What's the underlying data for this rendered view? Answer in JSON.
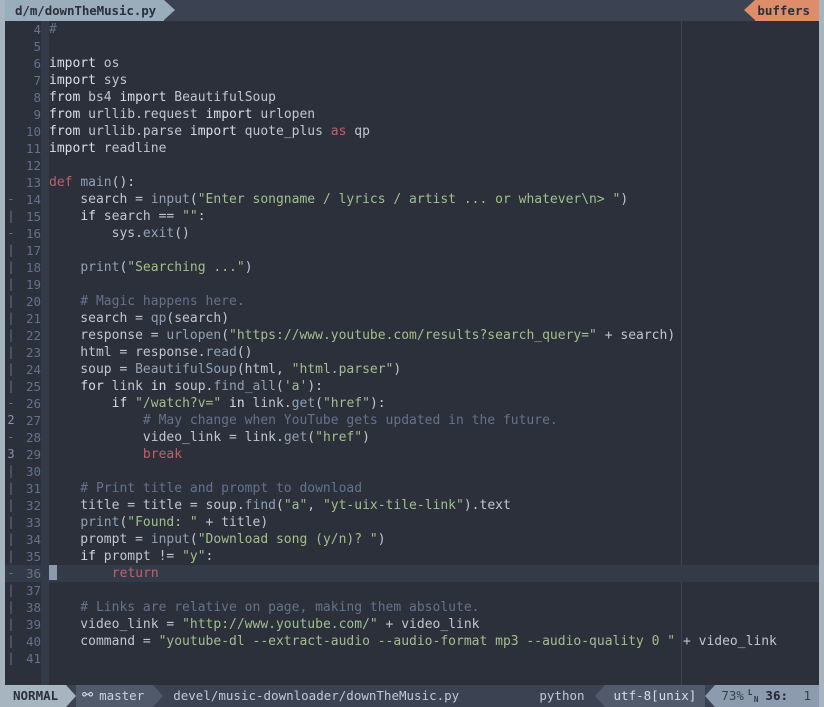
{
  "tabline": {
    "tab_label": "d/m/downTheMusic.py",
    "buffers_label": "buffers",
    "tab_bg": "#9aadbb",
    "buffers_bg": "#dd8d6a"
  },
  "editor": {
    "cursor_line": 36,
    "cursor_col": 1,
    "lines": [
      {
        "num": 4,
        "fold": "",
        "tokens": [
          {
            "t": "#",
            "c": "com"
          }
        ]
      },
      {
        "num": 5,
        "fold": "",
        "tokens": []
      },
      {
        "num": 6,
        "fold": "",
        "tokens": [
          {
            "t": "import",
            "c": "kw2"
          },
          {
            "t": " os",
            "c": "id"
          }
        ]
      },
      {
        "num": 7,
        "fold": "",
        "tokens": [
          {
            "t": "import",
            "c": "kw2"
          },
          {
            "t": " sys",
            "c": "id"
          }
        ]
      },
      {
        "num": 8,
        "fold": "",
        "tokens": [
          {
            "t": "from",
            "c": "kw2"
          },
          {
            "t": " bs4 ",
            "c": "id"
          },
          {
            "t": "import",
            "c": "kw2"
          },
          {
            "t": " BeautifulSoup",
            "c": "id"
          }
        ]
      },
      {
        "num": 9,
        "fold": "",
        "tokens": [
          {
            "t": "from",
            "c": "kw2"
          },
          {
            "t": " urllib.request ",
            "c": "id"
          },
          {
            "t": "import",
            "c": "kw2"
          },
          {
            "t": " urlopen",
            "c": "id"
          }
        ]
      },
      {
        "num": 10,
        "fold": "",
        "tokens": [
          {
            "t": "from",
            "c": "kw2"
          },
          {
            "t": " urllib.parse ",
            "c": "id"
          },
          {
            "t": "import",
            "c": "kw2"
          },
          {
            "t": " quote_plus ",
            "c": "id"
          },
          {
            "t": "as",
            "c": "kw"
          },
          {
            "t": " qp",
            "c": "id"
          }
        ]
      },
      {
        "num": 11,
        "fold": "",
        "tokens": [
          {
            "t": "import",
            "c": "kw2"
          },
          {
            "t": " readline",
            "c": "id"
          }
        ]
      },
      {
        "num": 12,
        "fold": "",
        "tokens": []
      },
      {
        "num": 13,
        "fold": "",
        "tokens": [
          {
            "t": "def",
            "c": "kw"
          },
          {
            "t": " ",
            "c": "id"
          },
          {
            "t": "main",
            "c": "fn"
          },
          {
            "t": "():",
            "c": "op"
          }
        ]
      },
      {
        "num": 14,
        "fold": "-",
        "tokens": [
          {
            "t": "    search = ",
            "c": "id"
          },
          {
            "t": "input",
            "c": "fn"
          },
          {
            "t": "(",
            "c": "op"
          },
          {
            "t": "\"Enter songname / lyrics / artist ... or whatever\\n> \"",
            "c": "str"
          },
          {
            "t": ")",
            "c": "op"
          }
        ]
      },
      {
        "num": 15,
        "fold": "|",
        "tokens": [
          {
            "t": "    ",
            "c": "id"
          },
          {
            "t": "if",
            "c": "kw2"
          },
          {
            "t": " search == ",
            "c": "id"
          },
          {
            "t": "\"\"",
            "c": "str"
          },
          {
            "t": ":",
            "c": "op"
          }
        ]
      },
      {
        "num": 16,
        "fold": "-",
        "tokens": [
          {
            "t": "        sys.",
            "c": "id"
          },
          {
            "t": "exit",
            "c": "fn"
          },
          {
            "t": "()",
            "c": "op"
          }
        ]
      },
      {
        "num": 17,
        "fold": "|",
        "tokens": []
      },
      {
        "num": 18,
        "fold": "|",
        "tokens": [
          {
            "t": "    ",
            "c": "id"
          },
          {
            "t": "print",
            "c": "fn"
          },
          {
            "t": "(",
            "c": "op"
          },
          {
            "t": "\"Searching ...\"",
            "c": "str"
          },
          {
            "t": ")",
            "c": "op"
          }
        ]
      },
      {
        "num": 19,
        "fold": "|",
        "tokens": []
      },
      {
        "num": 20,
        "fold": "|",
        "tokens": [
          {
            "t": "    # Magic happens here.",
            "c": "com"
          }
        ]
      },
      {
        "num": 21,
        "fold": "|",
        "tokens": [
          {
            "t": "    search = ",
            "c": "id"
          },
          {
            "t": "qp",
            "c": "fn"
          },
          {
            "t": "(search)",
            "c": "op"
          }
        ]
      },
      {
        "num": 22,
        "fold": "|",
        "tokens": [
          {
            "t": "    response = ",
            "c": "id"
          },
          {
            "t": "urlopen",
            "c": "fn"
          },
          {
            "t": "(",
            "c": "op"
          },
          {
            "t": "\"https://www.youtube.com/results?search_query=\"",
            "c": "str"
          },
          {
            "t": " + search)",
            "c": "id"
          }
        ]
      },
      {
        "num": 23,
        "fold": "|",
        "tokens": [
          {
            "t": "    html = response.",
            "c": "id"
          },
          {
            "t": "read",
            "c": "fn"
          },
          {
            "t": "()",
            "c": "op"
          }
        ]
      },
      {
        "num": 24,
        "fold": "|",
        "tokens": [
          {
            "t": "    soup = ",
            "c": "id"
          },
          {
            "t": "BeautifulSoup",
            "c": "fn"
          },
          {
            "t": "(html, ",
            "c": "op"
          },
          {
            "t": "\"html.parser\"",
            "c": "str"
          },
          {
            "t": ")",
            "c": "op"
          }
        ]
      },
      {
        "num": 25,
        "fold": "|",
        "tokens": [
          {
            "t": "    ",
            "c": "id"
          },
          {
            "t": "for",
            "c": "kw2"
          },
          {
            "t": " link ",
            "c": "id"
          },
          {
            "t": "in",
            "c": "kw2"
          },
          {
            "t": " soup.",
            "c": "id"
          },
          {
            "t": "find_all",
            "c": "fn"
          },
          {
            "t": "(",
            "c": "op"
          },
          {
            "t": "'a'",
            "c": "str"
          },
          {
            "t": "):",
            "c": "op"
          }
        ]
      },
      {
        "num": 26,
        "fold": "-",
        "tokens": [
          {
            "t": "        ",
            "c": "id"
          },
          {
            "t": "if",
            "c": "kw2"
          },
          {
            "t": " ",
            "c": "id"
          },
          {
            "t": "\"/watch?v=\"",
            "c": "str"
          },
          {
            "t": " ",
            "c": "id"
          },
          {
            "t": "in",
            "c": "kw2"
          },
          {
            "t": " link.",
            "c": "id"
          },
          {
            "t": "get",
            "c": "fn"
          },
          {
            "t": "(",
            "c": "op"
          },
          {
            "t": "\"href\"",
            "c": "str"
          },
          {
            "t": "):",
            "c": "op"
          }
        ]
      },
      {
        "num": 27,
        "fold": "2",
        "tokens": [
          {
            "t": "            # May change when YouTube gets updated in the future.",
            "c": "com"
          }
        ]
      },
      {
        "num": 28,
        "fold": "-",
        "tokens": [
          {
            "t": "            video_link = link.",
            "c": "id"
          },
          {
            "t": "get",
            "c": "fn"
          },
          {
            "t": "(",
            "c": "op"
          },
          {
            "t": "\"href\"",
            "c": "str"
          },
          {
            "t": ")",
            "c": "op"
          }
        ]
      },
      {
        "num": 29,
        "fold": "3",
        "tokens": [
          {
            "t": "            ",
            "c": "id"
          },
          {
            "t": "break",
            "c": "kw"
          }
        ]
      },
      {
        "num": 30,
        "fold": "|",
        "tokens": []
      },
      {
        "num": 31,
        "fold": "|",
        "tokens": [
          {
            "t": "    # Print title and prompt to download",
            "c": "com"
          }
        ]
      },
      {
        "num": 32,
        "fold": "|",
        "tokens": [
          {
            "t": "    title = title = soup.",
            "c": "id"
          },
          {
            "t": "find",
            "c": "fn"
          },
          {
            "t": "(",
            "c": "op"
          },
          {
            "t": "\"a\"",
            "c": "str"
          },
          {
            "t": ", ",
            "c": "op"
          },
          {
            "t": "\"yt-uix-tile-link\"",
            "c": "str"
          },
          {
            "t": ").text",
            "c": "id"
          }
        ]
      },
      {
        "num": 33,
        "fold": "|",
        "tokens": [
          {
            "t": "    ",
            "c": "id"
          },
          {
            "t": "print",
            "c": "fn"
          },
          {
            "t": "(",
            "c": "op"
          },
          {
            "t": "\"Found: \"",
            "c": "str"
          },
          {
            "t": " + title)",
            "c": "id"
          }
        ]
      },
      {
        "num": 34,
        "fold": "|",
        "tokens": [
          {
            "t": "    prompt = ",
            "c": "id"
          },
          {
            "t": "input",
            "c": "fn"
          },
          {
            "t": "(",
            "c": "op"
          },
          {
            "t": "\"Download song (y/n)? \"",
            "c": "str"
          },
          {
            "t": ")",
            "c": "op"
          }
        ]
      },
      {
        "num": 35,
        "fold": "|",
        "tokens": [
          {
            "t": "    ",
            "c": "id"
          },
          {
            "t": "if",
            "c": "kw2"
          },
          {
            "t": " prompt != ",
            "c": "id"
          },
          {
            "t": "\"y\"",
            "c": "str"
          },
          {
            "t": ":",
            "c": "op"
          }
        ]
      },
      {
        "num": 36,
        "fold": "-",
        "tokens": [
          {
            "t": "        ",
            "c": "id"
          },
          {
            "t": "return",
            "c": "kw"
          }
        ],
        "cursor": true
      },
      {
        "num": 37,
        "fold": "|",
        "tokens": []
      },
      {
        "num": 38,
        "fold": "|",
        "tokens": [
          {
            "t": "    # Links are relative on page, making them absolute.",
            "c": "com"
          }
        ]
      },
      {
        "num": 39,
        "fold": "|",
        "tokens": [
          {
            "t": "    video_link = ",
            "c": "id"
          },
          {
            "t": "\"http://www.youtube.com/\"",
            "c": "str"
          },
          {
            "t": " + video_link",
            "c": "id"
          }
        ]
      },
      {
        "num": 40,
        "fold": "|",
        "tokens": [
          {
            "t": "    command = ",
            "c": "id"
          },
          {
            "t": "\"youtube-dl --extract-audio --audio-format mp3 --audio-quality 0 \"",
            "c": "str"
          },
          {
            "t": " + video_link",
            "c": "id"
          }
        ]
      },
      {
        "num": 41,
        "fold": "|",
        "tokens": []
      }
    ]
  },
  "statusline": {
    "mode": "NORMAL",
    "branch_icon": "branch-icon",
    "branch": "master",
    "file_path": "devel/music-downloader/downTheMusic.py",
    "filetype": "python",
    "encoding": "utf-8[unix]",
    "percent": "73%",
    "line_glyph_top": "L",
    "line_glyph_bottom": "N",
    "line": "36:",
    "col": "1"
  }
}
